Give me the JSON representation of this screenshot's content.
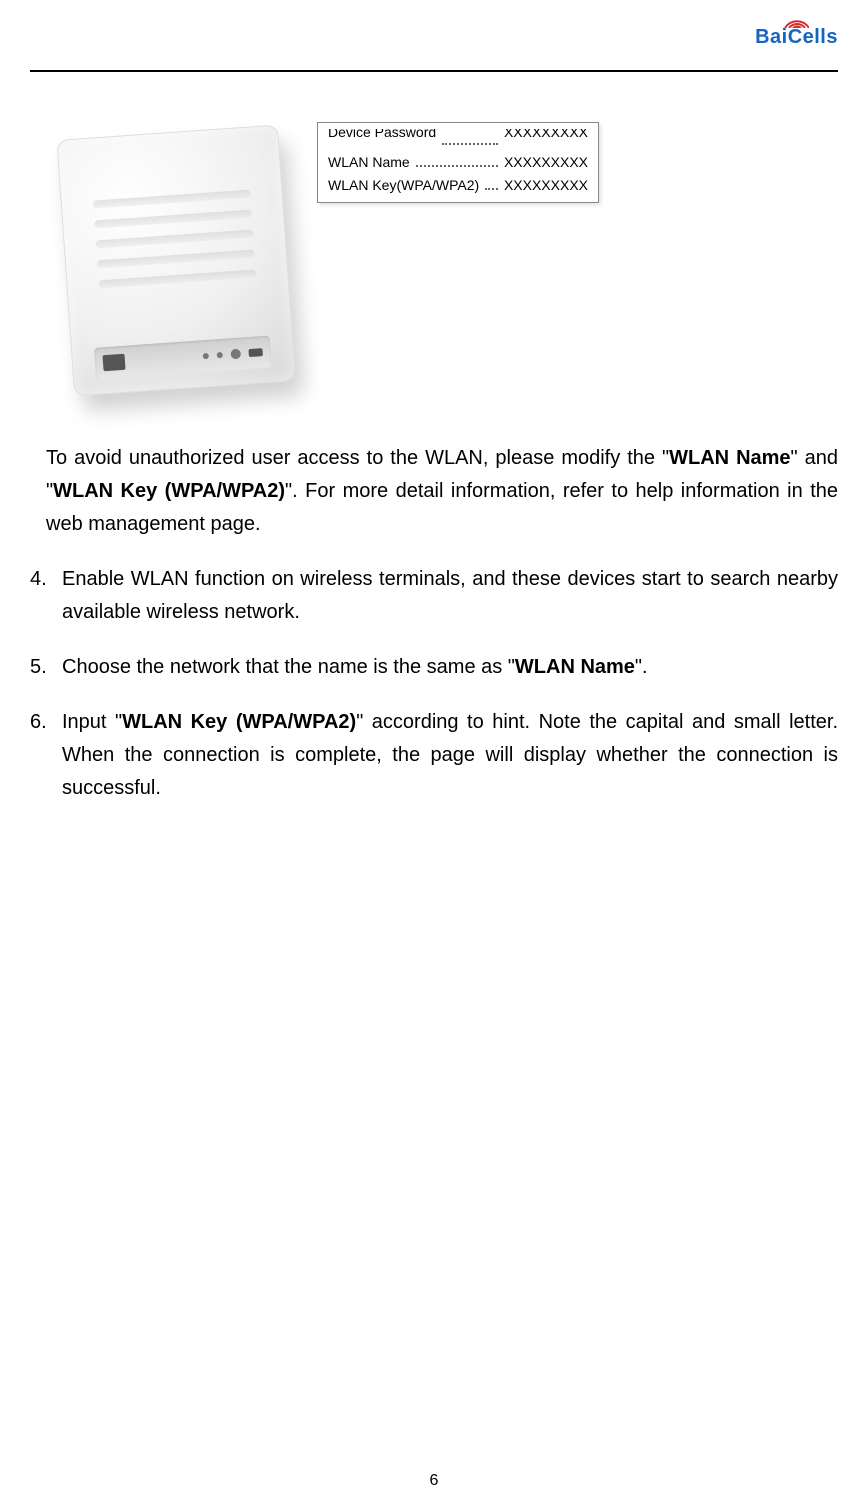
{
  "logo": {
    "text_bai": "Bai",
    "text_cells": "Cells"
  },
  "device_label": {
    "rows": [
      {
        "name": "Device Password",
        "value": "XXXXXXXXX",
        "cut": true
      },
      {
        "name": "WLAN Name",
        "value": "XXXXXXXXX",
        "cut": false
      },
      {
        "name": "WLAN Key(WPA/WPA2)",
        "value": "XXXXXXXXX",
        "cut": false
      }
    ]
  },
  "paragraphs": {
    "avoid_pre": "To avoid unauthorized user access to the WLAN, please modify the \"",
    "avoid_bold1": "WLAN Name",
    "avoid_mid": "\" and \"",
    "avoid_bold2": "WLAN Key (WPA/WPA2)",
    "avoid_post": "\". For more detail information, refer to help information in the web management page."
  },
  "steps": {
    "s4_num": "4.",
    "s4_text": "Enable WLAN function on wireless terminals, and these devices start to search nearby available wireless network.",
    "s5_num": "5.",
    "s5_pre": "Choose the network that the name is the same as \"",
    "s5_bold": "WLAN Name",
    "s5_post": "\".",
    "s6_num": "6.",
    "s6_pre": "Input \"",
    "s6_bold": "WLAN Key (WPA/WPA2)",
    "s6_post": "\" according to hint. Note the capital and small letter. When the connection is complete, the page will display whether the connection is successful."
  },
  "page_number": "6"
}
